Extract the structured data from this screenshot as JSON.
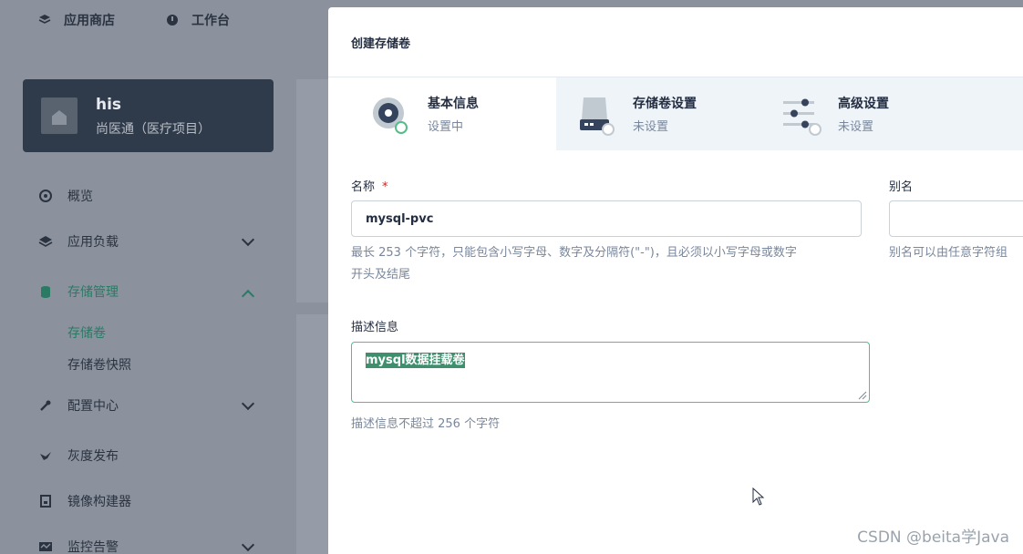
{
  "topnav": {
    "app_store": "应用商店",
    "workbench": "工作台"
  },
  "workspace": {
    "name": "his",
    "description": "尚医通（医疗项目）"
  },
  "sidebar": {
    "items": [
      {
        "label": "概览",
        "icon": "overview-icon"
      },
      {
        "label": "应用负载",
        "icon": "layers-icon"
      },
      {
        "label": "存储管理",
        "icon": "database-icon"
      },
      {
        "label": "配置中心",
        "icon": "wrench-icon"
      },
      {
        "label": "灰度发布",
        "icon": "bird-icon"
      },
      {
        "label": "镜像构建器",
        "icon": "image-icon"
      },
      {
        "label": "监控告警",
        "icon": "monitor-icon"
      }
    ],
    "sub_items": [
      {
        "label": "存储卷"
      },
      {
        "label": "存储卷快照"
      }
    ]
  },
  "modal": {
    "title": "创建存储卷",
    "steps": [
      {
        "title": "基本信息",
        "status": "设置中",
        "icon": "disc-icon"
      },
      {
        "title": "存储卷设置",
        "status": "未设置",
        "icon": "hard-drive-icon"
      },
      {
        "title": "高级设置",
        "status": "未设置",
        "icon": "sliders-icon"
      }
    ],
    "form": {
      "name_label": "名称",
      "name_required": "*",
      "name_value": "mysql-pvc",
      "name_hint_line1": "最长 253 个字符，只能包含小写字母、数字及分隔符(\"-\")，且必须以小写字母或数字",
      "name_hint_line2": "开头及结尾",
      "alias_label": "别名",
      "alias_value": "",
      "alias_hint": "别名可以由任意字符组",
      "desc_label": "描述信息",
      "desc_value": "mysql数据挂载卷",
      "desc_hint": "描述信息不超过 256 个字符"
    }
  },
  "watermark": "CSDN @beita学Java",
  "colors": {
    "accent": "#55bc8a",
    "selection": "#3e8f6d",
    "overlay": "#8b929e",
    "workspace_card": "#2f3a4a"
  }
}
